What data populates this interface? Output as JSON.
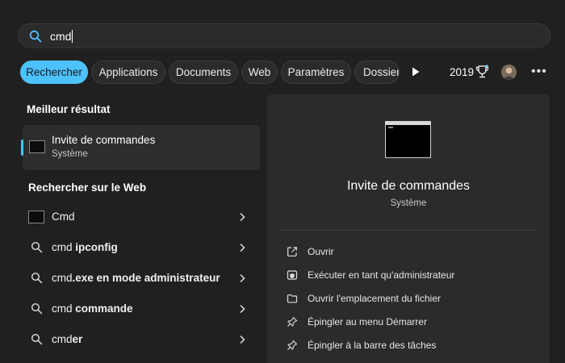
{
  "search": {
    "query": "cmd"
  },
  "filters": [
    "Rechercher",
    "Applications",
    "Documents",
    "Web",
    "Paramètres",
    "Dossier"
  ],
  "header": {
    "points": "2019"
  },
  "best_match": {
    "heading": "Meilleur résultat",
    "name": "Invite de commandes",
    "subtitle": "Système"
  },
  "web": {
    "heading": "Rechercher sur le Web",
    "items": [
      {
        "prefix": "Cmd",
        "bold": ""
      },
      {
        "prefix": "cmd ",
        "bold": "ipconfig"
      },
      {
        "prefix": "cmd",
        "bold": ".exe en mode administrateur"
      },
      {
        "prefix": "cmd ",
        "bold": "commande"
      },
      {
        "prefix": "cmd",
        "bold": "er"
      }
    ]
  },
  "detail": {
    "name": "Invite de commandes",
    "subtitle": "Système",
    "actions": [
      {
        "label": "Ouvrir",
        "icon": "open-external-icon"
      },
      {
        "label": "Exécuter en tant qu'administrateur",
        "icon": "shield-icon"
      },
      {
        "label": "Ouvrir l'emplacement du fichier",
        "icon": "folder-icon"
      },
      {
        "label": "Épingler au menu Démarrer",
        "icon": "pin-icon"
      },
      {
        "label": "Épingler à la barre des tâches",
        "icon": "pin-icon"
      }
    ]
  },
  "colors": {
    "accent": "#4cc2ff",
    "background": "#202020",
    "detail_bg": "#2b2b2b"
  }
}
